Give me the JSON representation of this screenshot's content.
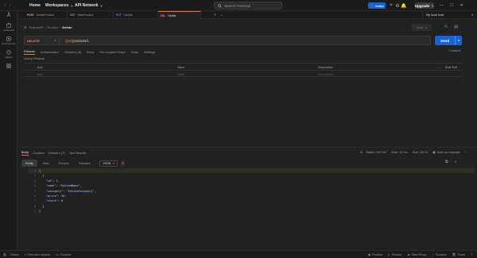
{
  "topbar": {
    "home": "Home",
    "workspaces": "Workspaces",
    "api_network": "API Network",
    "search_placeholder": "Search Postman",
    "invite": "Invite",
    "upgrade": "Upgrade"
  },
  "sidebar": {
    "items": [
      {
        "label": "Collections",
        "icon": "collections-icon"
      },
      {
        "label": "Environments",
        "icon": "environments-icon"
      },
      {
        "label": "History",
        "icon": "history-icon"
      },
      {
        "label": "",
        "icon": "apps-icon"
      }
    ]
  },
  "tabs": [
    {
      "method": "POST",
      "method_color": "#f0b455",
      "name": "CreateProduct",
      "active": false
    },
    {
      "method": "GET",
      "method_color": "#53c07a",
      "name": "MainProduct",
      "active": false
    },
    {
      "method": "PUT",
      "method_color": "#5a9cf0",
      "name": "Update",
      "active": false
    },
    {
      "method": "DEL",
      "method_color": "#ff7a61",
      "name": "Delete",
      "active": true
    }
  ],
  "environment": "My local host",
  "breadcrumb": {
    "parts": [
      "OnlineAPI",
      "Product"
    ],
    "current": "Delete"
  },
  "save_label": "Save",
  "request": {
    "method": "DELETE",
    "url_variable": "{{url}}",
    "url_rest": "products/1",
    "send_label": "Send",
    "subtabs": [
      "Params",
      "Authorization",
      "Headers (8)",
      "Body",
      "Pre-request Script",
      "Tests",
      "Settings"
    ],
    "active_subtab": "Params",
    "cookies_label": "Cookies",
    "query_params_label": "Query Params",
    "table_headers": {
      "key": "Key",
      "value": "Value",
      "description": "Description",
      "bulk_edit": "Bulk Edit"
    },
    "table_placeholders": {
      "key": "Key",
      "value": "Value",
      "description": "Description"
    }
  },
  "response": {
    "subtabs": [
      "Body",
      "Cookies",
      "Headers (7)",
      "Test Results"
    ],
    "active_subtab": "Body",
    "status_label": "Status:",
    "status_value": "200 OK",
    "time_label": "Time:",
    "time_value": "22 ms",
    "size_label": "Size:",
    "size_value": "394 B",
    "save_example": "Save as example",
    "formats": [
      "Pretty",
      "Raw",
      "Preview",
      "Visualize"
    ],
    "active_format": "Pretty",
    "format_type": "JSON",
    "code_lines": [
      {
        "n": "1",
        "text": "{",
        "highlight": true
      },
      {
        "n": "2",
        "text": "  {"
      },
      {
        "n": "3",
        "text": "    \"id\": 1,"
      },
      {
        "n": "4",
        "text": "    \"name\": \"EditedName\","
      },
      {
        "n": "5",
        "text": "    \"category\": \"EditedCategory\","
      },
      {
        "n": "6",
        "text": "    \"price\": 50,"
      },
      {
        "n": "7",
        "text": "    \"stock\": 0"
      },
      {
        "n": "8",
        "text": "  }"
      },
      {
        "n": "9",
        "text": "}"
      }
    ]
  },
  "statusbar": {
    "left": [
      "Online",
      "Find and replace",
      "Console"
    ],
    "right": [
      "Postbot",
      "Runner",
      "Start Proxy",
      "Cookies",
      "Trash"
    ]
  },
  "colors": {
    "accent": "#ff6c37",
    "send": "#1763d6",
    "status_ok": "#53c07a"
  }
}
